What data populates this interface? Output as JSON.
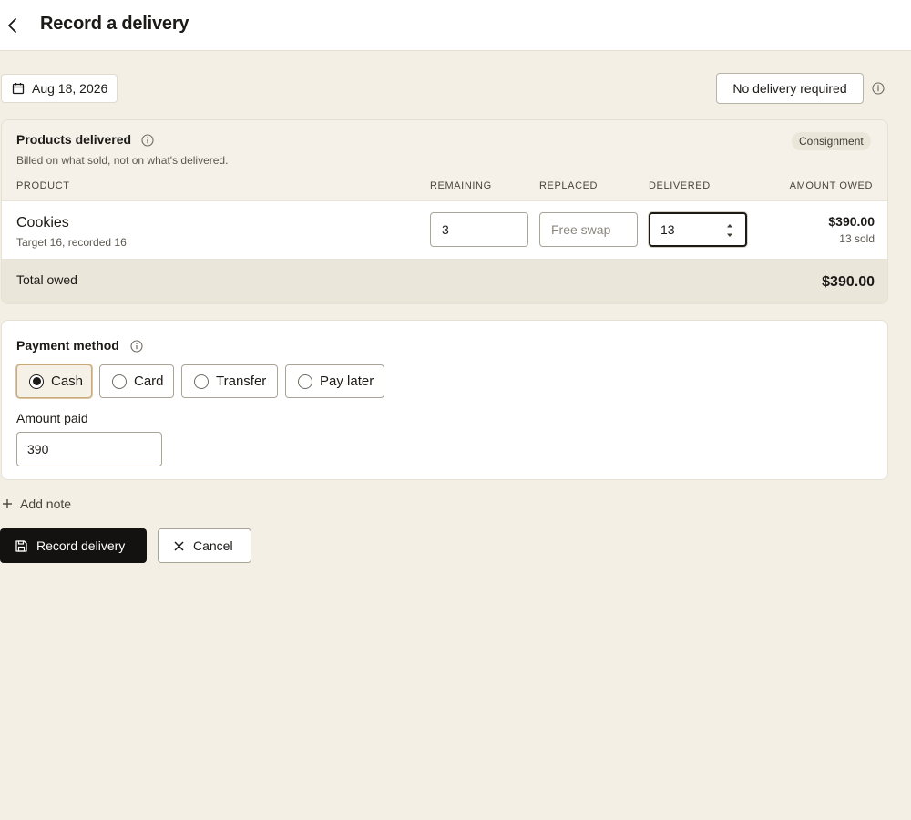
{
  "header": {
    "title": "Record a delivery",
    "back_icon": "chevron-left-icon"
  },
  "toolbar": {
    "date_label": "Aug 18, 2026",
    "no_delivery_label": "No delivery required"
  },
  "products": {
    "title": "Products delivered",
    "subtitle": "Billed on what sold, not on what's delivered.",
    "badge": "Consignment",
    "columns": {
      "product": "PRODUCT",
      "remaining": "REMAINING",
      "replaced": "REPLACED",
      "delivered": "DELIVERED",
      "amount_owed": "AMOUNT OWED"
    },
    "rows": [
      {
        "name": "Cookies",
        "meta": "Target 16, recorded 16",
        "remaining": "3",
        "replaced_placeholder": "Free swap",
        "delivered": "13",
        "amount": "$390.00",
        "sold": "13 sold"
      }
    ],
    "total_label": "Total owed",
    "total_amount": "$390.00"
  },
  "payment": {
    "title": "Payment method",
    "options": [
      "Cash",
      "Card",
      "Transfer",
      "Pay later"
    ],
    "selected": "Cash",
    "amount_label": "Amount paid",
    "amount_value": "390"
  },
  "actions": {
    "add_note": "Add note",
    "record": "Record delivery",
    "cancel": "Cancel"
  },
  "colors": {
    "background": "#f3efe5",
    "primary_button": "#141210",
    "selected_outline": "#c9a978"
  }
}
